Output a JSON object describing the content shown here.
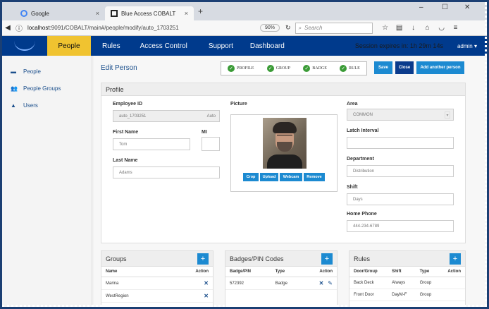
{
  "browser": {
    "tabs": [
      {
        "label": "Google",
        "close": "×"
      },
      {
        "label": "Blue Access COBALT",
        "close": "×"
      }
    ],
    "new_tab": "+",
    "window_controls": [
      "–",
      "☐",
      "✕"
    ],
    "url_host": "localhost",
    "url_rest": ":9091/COBALT/main#/people/modify/auto_1703251",
    "zoom": "90%",
    "search_placeholder": "Search"
  },
  "header": {
    "active_nav": "People",
    "nav": [
      "Rules",
      "Access Control",
      "Support",
      "Dashboard"
    ],
    "session": "Session expires in: 1h 29m 14s",
    "user": "admin"
  },
  "sidebar": {
    "items": [
      {
        "label": "People",
        "icon": "id-card-icon"
      },
      {
        "label": "People Groups",
        "icon": "users-icon"
      },
      {
        "label": "Users",
        "icon": "user-icon"
      }
    ]
  },
  "page": {
    "title": "Edit Person",
    "steps": [
      "PROFILE",
      "GROUP",
      "BADGE",
      "RULE"
    ],
    "buttons": {
      "save": "Save",
      "close": "Close",
      "add": "Add another person"
    }
  },
  "profile": {
    "section_title": "Profile",
    "employee_id_label": "Employee ID",
    "employee_id": "auto_1703251",
    "employee_id_suffix": "Auto",
    "first_name_label": "First Name",
    "first_name": "Tom",
    "mi_label": "MI",
    "mi": "",
    "last_name_label": "Last Name",
    "last_name": "Adams",
    "picture_label": "Picture",
    "picture_buttons": [
      "Crop",
      "Upload",
      "Webcam",
      "Remove"
    ],
    "area_label": "Area",
    "area": "COMMON",
    "latch_label": "Latch Interval",
    "latch": "",
    "department_label": "Department",
    "department": "Distribution",
    "shift_label": "Shift",
    "shift": "Days",
    "phone_label": "Home Phone",
    "phone": "444-234-6789"
  },
  "groups": {
    "title": "Groups",
    "columns": [
      "Name",
      "Action"
    ],
    "rows": [
      [
        "Marina"
      ],
      [
        "WestRegion"
      ]
    ]
  },
  "badges": {
    "title": "Badges/PIN Codes",
    "columns": [
      "Badge/PIN",
      "Type",
      "Action"
    ],
    "rows": [
      [
        "572392",
        "Badge"
      ]
    ]
  },
  "rules": {
    "title": "Rules",
    "columns": [
      "Door/Group",
      "Shift",
      "Type",
      "Action"
    ],
    "rows": [
      [
        "Back Deck",
        "Always",
        "Group"
      ],
      [
        "Front Door",
        "DayM-F",
        "Group"
      ]
    ]
  },
  "colors": {
    "header_bg": "#003a8c",
    "active_nav_bg": "#f0c330",
    "primary_button": "#1c8ad1",
    "dark_button": "#0b3b8c",
    "step_check": "#3a9b36"
  }
}
